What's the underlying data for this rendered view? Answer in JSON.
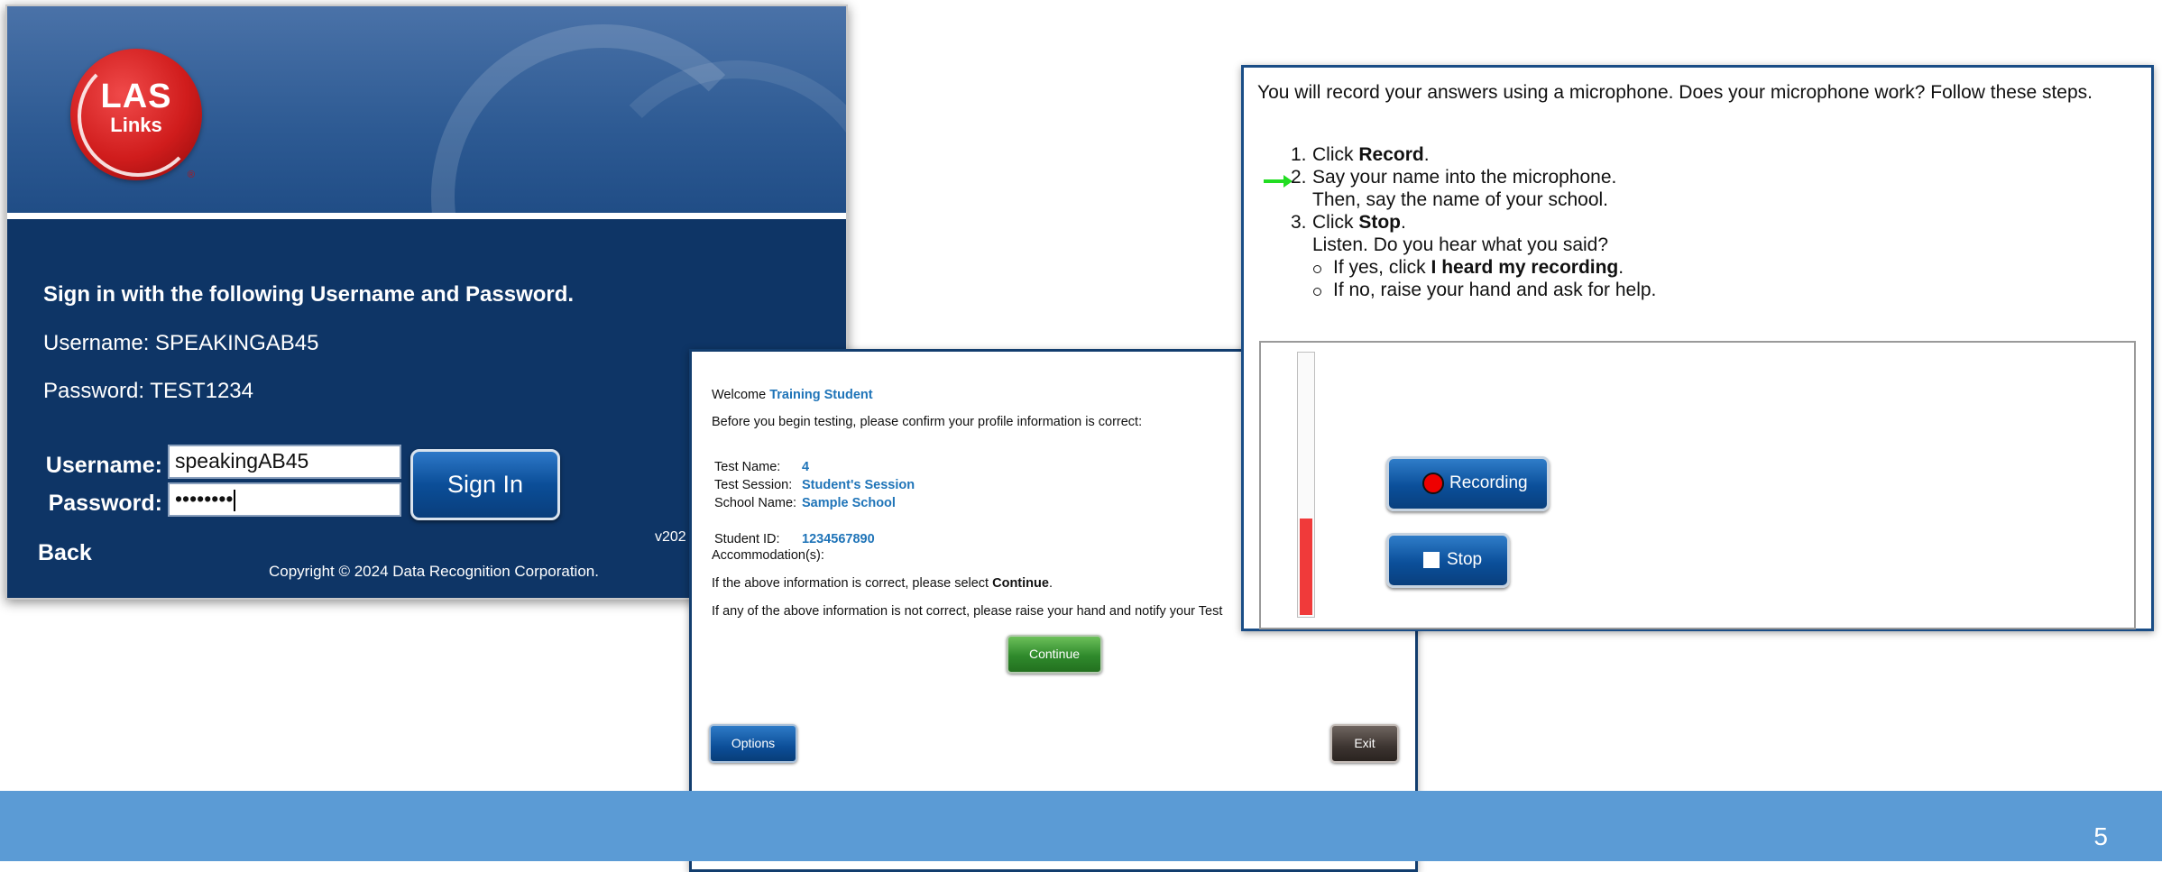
{
  "slide": {
    "page_number": "5",
    "footer_color": "#5b9bd5"
  },
  "login": {
    "logo": {
      "line1": "LAS",
      "line2": "Links",
      "reg": "®",
      "icon": "las-links-logo"
    },
    "instruction": "Sign in with the following Username and Password.",
    "username_line": "Username: SPEAKINGAB45",
    "password_line": "Password: TEST1234",
    "username_label": "Username:",
    "password_label": "Password:",
    "username_value": "speakingAB45",
    "password_value": "••••••••",
    "sign_in": "Sign In",
    "back": "Back",
    "version": "v202",
    "copyright": "Copyright © 2024 Data Recognition Corporation."
  },
  "welcome": {
    "welcome_prefix": "Welcome",
    "student_name": "Training Student",
    "before": "Before you begin testing, please confirm your profile information is correct:",
    "rows": [
      {
        "label": "Test Name:",
        "value": "4"
      },
      {
        "label": "Test Session:",
        "value": "Student's Session"
      },
      {
        "label": "School Name:",
        "value": "Sample School"
      },
      {
        "label": "Student ID:",
        "value": "1234567890"
      },
      {
        "label": "Accommodation(s):",
        "value": ""
      }
    ],
    "confirm_prefix": "If the above information is correct, please select",
    "confirm_bold": "Continue",
    "confirm_suffix": ".",
    "not_correct": "If any of the above information is not correct, please raise your hand and notify your Test",
    "continue": "Continue",
    "options": "Options",
    "exit": "Exit"
  },
  "mic": {
    "intro": "You will record your answers using a microphone. Does your microphone work? Follow these steps.",
    "steps": [
      {
        "num": "1.",
        "pre": "Click ",
        "bold": "Record",
        "post": "."
      },
      {
        "num": "2.",
        "pre": "Say your name into the microphone.",
        "bold": "",
        "post": ""
      },
      {
        "num": "",
        "pre": "Then, say the name of your school.",
        "bold": "",
        "post": ""
      },
      {
        "num": "3.",
        "pre": "Click ",
        "bold": "Stop",
        "post": "."
      },
      {
        "num": "",
        "pre": "Listen. Do you hear what you said?",
        "bold": "",
        "post": ""
      }
    ],
    "bullets": [
      {
        "pre": "If yes, click ",
        "bold": "I heard my recording",
        "post": "."
      },
      {
        "pre": "If no, raise your hand and ask for help.",
        "bold": "",
        "post": ""
      }
    ],
    "current_step_arrow_color": "#22dd22",
    "level_meter": 0.38,
    "record": "Recording",
    "stop": "Stop"
  }
}
